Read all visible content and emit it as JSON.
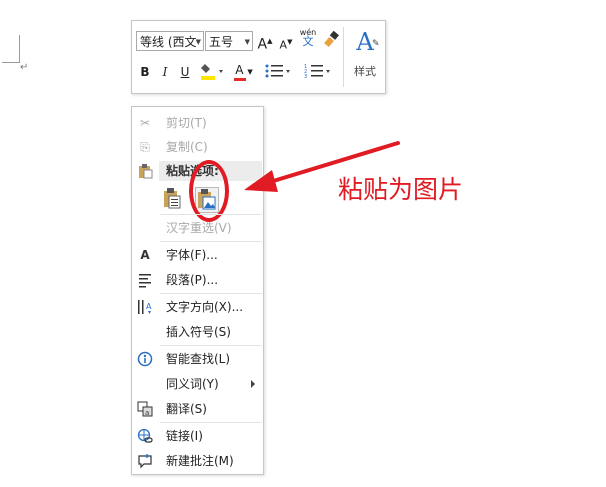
{
  "toolbar": {
    "font_name": "等线 (西文",
    "font_size": "五号",
    "styles_label": "样式",
    "pinyin_top": "wén",
    "pinyin_bottom": "文",
    "bold": "B",
    "italic": "I",
    "underline": "U",
    "font_color_letter": "A",
    "grow_font": "A",
    "shrink_font": "A",
    "styles_letter": "A"
  },
  "menu": {
    "cut": "剪切(T)",
    "copy": "复制(C)",
    "paste_options": "粘贴选项:",
    "hanzi_reconvert": "汉字重选(V)",
    "font": "字体(F)...",
    "paragraph": "段落(P)...",
    "text_direction": "文字方向(X)...",
    "insert_symbol": "插入符号(S)",
    "smart_lookup": "智能查找(L)",
    "synonyms": "同义词(Y)",
    "translate": "翻译(S)",
    "link": "链接(I)",
    "new_comment": "新建批注(M)",
    "font_icon_letter": "A"
  },
  "annotation": {
    "text": "粘贴为图片",
    "color": "#e11b23"
  },
  "colors": {
    "highlight_yellow": "#ffe600",
    "font_color_red": "#e32b2b",
    "accent_blue": "#2b6fc4"
  }
}
